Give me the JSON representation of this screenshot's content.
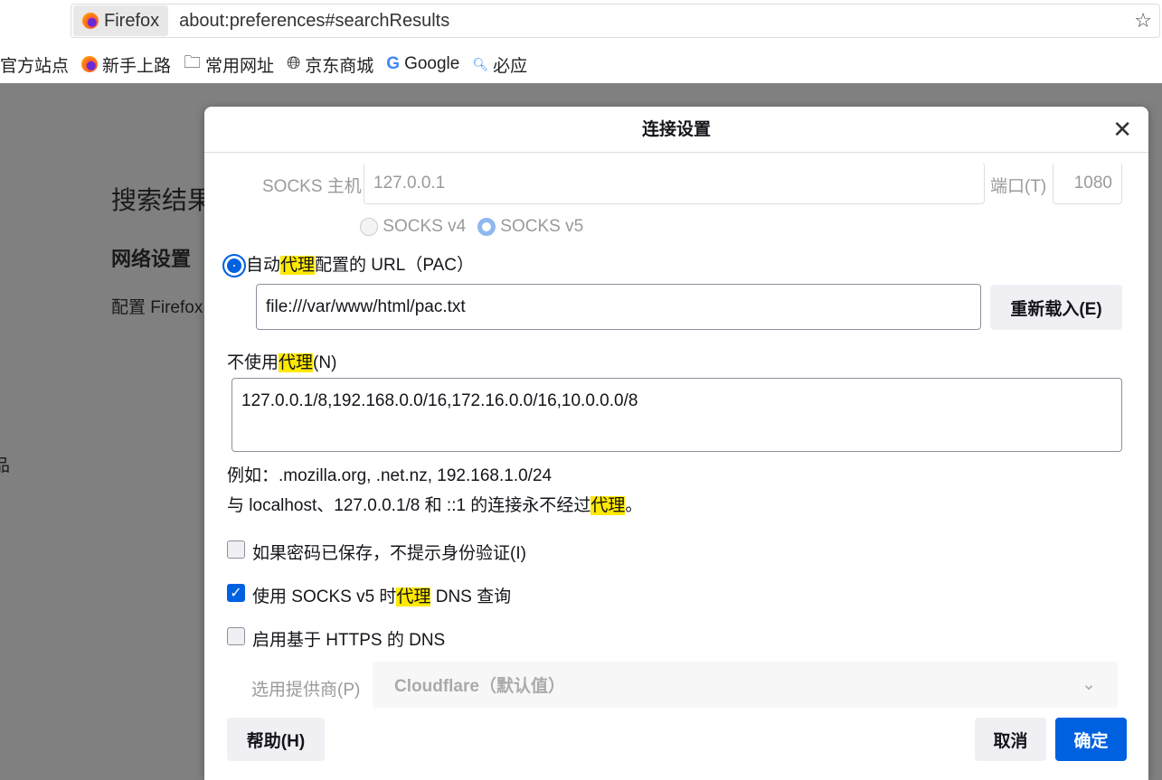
{
  "browser": {
    "identity": "Firefox",
    "url": "about:preferences#searchResults",
    "bookmarks": [
      "官方站点",
      "新手上路",
      "常用网址",
      "京东商城",
      "Google",
      "必应"
    ]
  },
  "background": {
    "title": "搜索结果",
    "section": "网络设置",
    "desc": "配置 Firefox",
    "edge": "品"
  },
  "dialog": {
    "title": "连接设置",
    "socks_host_label": "SOCKS 主机",
    "socks_host_value": "127.0.0.1",
    "port_label": "端口(T)",
    "port_value": "1080",
    "socks_v4": "SOCKS v4",
    "socks_v5": "SOCKS v5",
    "pac": {
      "pre": "自动",
      "hl": "代理",
      "post": "配置的 URL（PAC）",
      "value": "file:///var/www/html/pac.txt",
      "reload": "重新载入(E)",
      "selected": true
    },
    "no_proxy": {
      "pre": "不使用",
      "hl": "代理",
      "post": "(N)",
      "value": "127.0.0.1/8,192.168.0.0/16,172.16.0.0/16,10.0.0.0/8"
    },
    "example": "例如：.mozilla.org, .net.nz, 192.168.1.0/24",
    "localhost": {
      "pre": "与 localhost、127.0.0.1/8 和 ::1 的连接永不经过",
      "hl": "代理",
      "post": "。"
    },
    "cb_auth": {
      "label": "如果密码已保存，不提示身份验证(I)",
      "checked": false
    },
    "cb_dns": {
      "pre": "使用 SOCKS v5 时",
      "hl": "代理",
      "post": " DNS 查询",
      "checked": true
    },
    "cb_doh": {
      "label": "启用基于 HTTPS 的 DNS",
      "checked": false
    },
    "provider_label": "选用提供商(P)",
    "provider_value": "Cloudflare（默认值）",
    "help": "帮助(H)",
    "cancel": "取消",
    "ok": "确定"
  }
}
